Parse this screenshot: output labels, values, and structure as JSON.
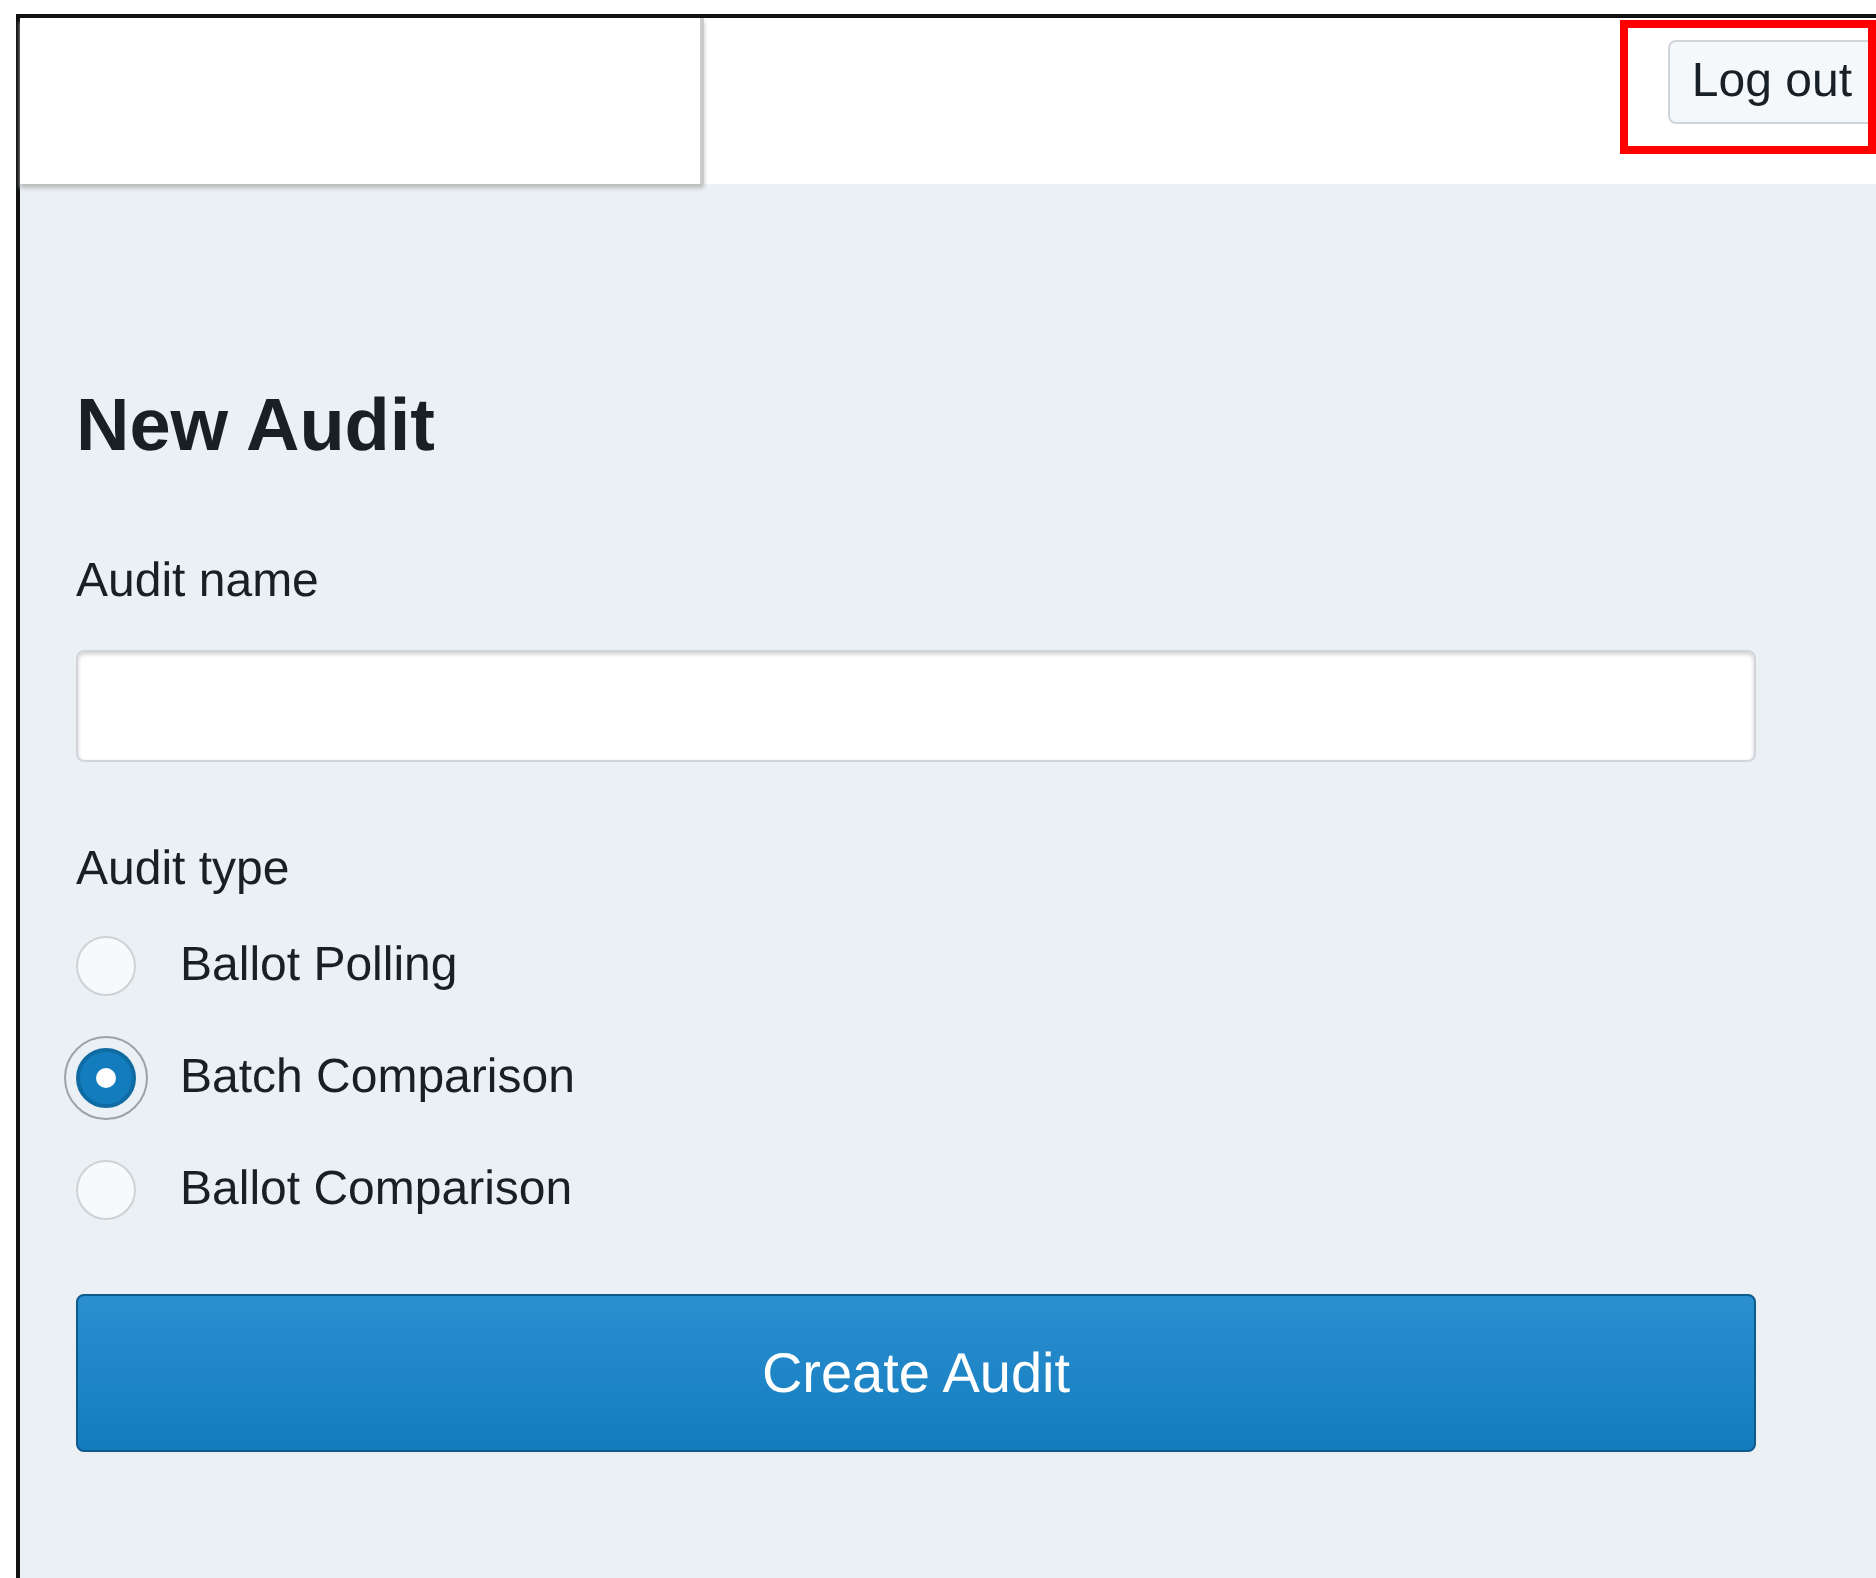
{
  "header": {
    "logout_button": "Log out",
    "highlighted": true
  },
  "form": {
    "title": "New Audit",
    "name_field": {
      "label": "Audit name"
    },
    "type_label": "Audit type",
    "audit_types": [
      {
        "label": "Ballot Polling",
        "selected": false
      },
      {
        "label": "Batch Comparison",
        "selected": true
      },
      {
        "label": "Ballot Comparison",
        "selected": false
      }
    ],
    "submit_button": "Create Audit"
  }
}
